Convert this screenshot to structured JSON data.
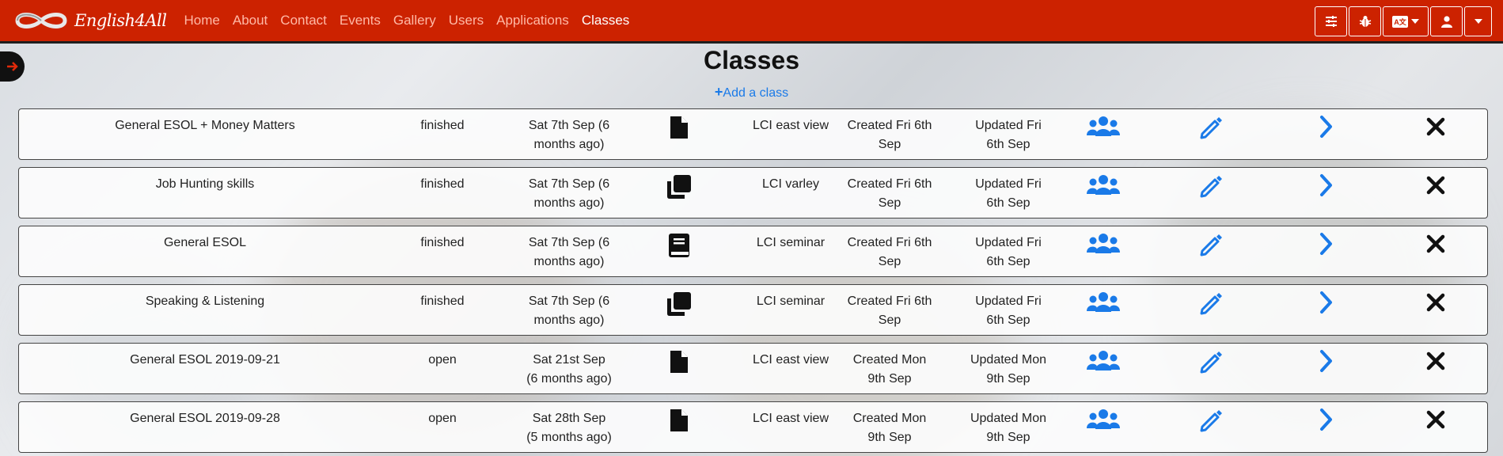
{
  "nav": {
    "brand": "English4All",
    "links": [
      {
        "label": "Home"
      },
      {
        "label": "About"
      },
      {
        "label": "Contact"
      },
      {
        "label": "Events"
      },
      {
        "label": "Gallery"
      },
      {
        "label": "Users"
      },
      {
        "label": "Applications"
      },
      {
        "label": "Classes"
      }
    ],
    "active": "Classes",
    "right_icons": [
      "sliders-icon",
      "bug-icon",
      "language-icon",
      "user-icon",
      "chevron-down-icon"
    ]
  },
  "page": {
    "title": "Classes",
    "add_label": "Add a class"
  },
  "classes": [
    {
      "name": "General ESOL + Money Matters",
      "status": "finished",
      "date_line1": "Sat 7th Sep (6",
      "date_line2": "months ago)",
      "type_icon": "file-icon",
      "venue": "LCI east view",
      "created_line1": "Created Fri 6th",
      "created_line2": "Sep",
      "updated_line1": "Updated Fri",
      "updated_line2": "6th Sep"
    },
    {
      "name": "Job Hunting skills",
      "status": "finished",
      "date_line1": "Sat 7th Sep (6",
      "date_line2": "months ago)",
      "type_icon": "copy-icon",
      "venue": "LCI varley",
      "created_line1": "Created Fri 6th",
      "created_line2": "Sep",
      "updated_line1": "Updated Fri",
      "updated_line2": "6th Sep"
    },
    {
      "name": "General ESOL",
      "status": "finished",
      "date_line1": "Sat 7th Sep (6",
      "date_line2": "months ago)",
      "type_icon": "book-icon",
      "venue": "LCI seminar",
      "created_line1": "Created Fri 6th",
      "created_line2": "Sep",
      "updated_line1": "Updated Fri",
      "updated_line2": "6th Sep"
    },
    {
      "name": "Speaking & Listening",
      "status": "finished",
      "date_line1": "Sat 7th Sep (6",
      "date_line2": "months ago)",
      "type_icon": "copy-icon",
      "venue": "LCI seminar",
      "created_line1": "Created Fri 6th",
      "created_line2": "Sep",
      "updated_line1": "Updated Fri",
      "updated_line2": "6th Sep"
    },
    {
      "name": "General ESOL 2019-09-21",
      "status": "open",
      "date_line1": "Sat 21st Sep",
      "date_line2": "(6 months ago)",
      "type_icon": "file-icon",
      "venue": "LCI east view",
      "created_line1": "Created Mon",
      "created_line2": "9th Sep",
      "updated_line1": "Updated Mon",
      "updated_line2": "9th Sep"
    },
    {
      "name": "General ESOL 2019-09-28",
      "status": "open",
      "date_line1": "Sat 28th Sep",
      "date_line2": "(5 months ago)",
      "type_icon": "file-icon",
      "venue": "LCI east view",
      "created_line1": "Created Mon",
      "created_line2": "9th Sep",
      "updated_line1": "Updated Mon",
      "updated_line2": "9th Sep"
    }
  ],
  "colors": {
    "navbar": "#cc2200",
    "nav_link": "#ffb9a6",
    "accent_blue": "#1a7ae8",
    "text": "#222222"
  }
}
